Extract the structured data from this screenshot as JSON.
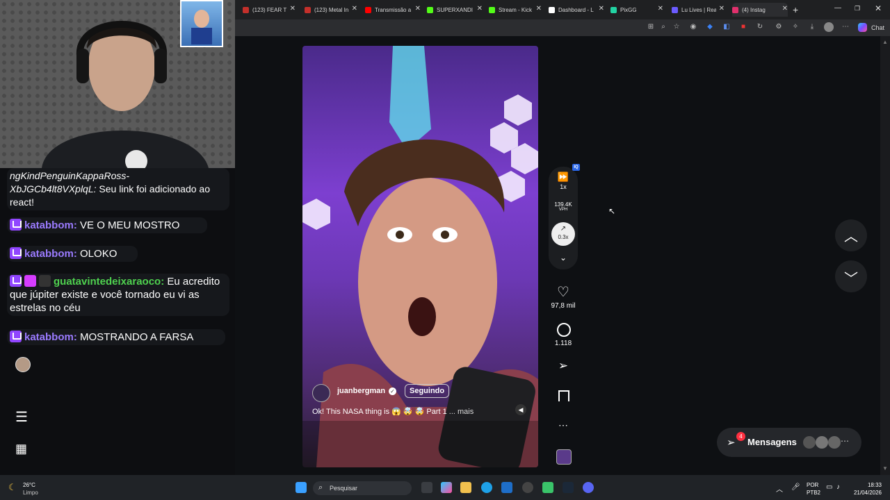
{
  "browser": {
    "tabs": [
      {
        "label": "(123) FEAR TI",
        "color": "#c4302b"
      },
      {
        "label": "(123) Metal In",
        "color": "#c4302b"
      },
      {
        "label": "Transmissão a",
        "color": "#ff0000"
      },
      {
        "label": "SUPERXANDI",
        "color": "#53fc18"
      },
      {
        "label": "Stream - Kick",
        "color": "#53fc18"
      },
      {
        "label": "Dashboard - L",
        "color": "#ffffff"
      },
      {
        "label": "PixGG",
        "color": "#22d3a3"
      },
      {
        "label": "Lu Lives | Rea",
        "color": "#6b5bff"
      },
      {
        "label": "(4) Instag",
        "color": "#e1306c"
      }
    ],
    "chat_label": "Chat"
  },
  "chat": {
    "messages": [
      {
        "user": "",
        "text": "ngKindPenguinKappaRoss-",
        "text2": "XbJGCb4lt8VXplqL:",
        "text3": "Seu link foi adicionado ao react!"
      },
      {
        "user": "katabbom:",
        "text": "VE O MEU MOSTRO"
      },
      {
        "user": "katabbom:",
        "text": "OLOKO"
      },
      {
        "user": "guatavintedeixaraoco:",
        "text": "Eu acredito que júpiter existe e você tornado eu vi as estrelas no céu"
      },
      {
        "user": "katabbom:",
        "text": "MOSTRANDO A FARSA"
      }
    ]
  },
  "reel": {
    "author": "juanbergman",
    "follow_label": "Seguindo",
    "caption": "Ok! This NASA thing is 😱 🤯 🤯 Part 1",
    "more_label": "... mais",
    "likes": "97,8 mil",
    "comments": "1.118"
  },
  "overlay_tool": {
    "speed": "1x",
    "views": "139.4K",
    "views_unit": "VPH",
    "ratio": "0.3x",
    "badge": "IQ"
  },
  "messages_panel": {
    "label": "Mensagens",
    "count": "4"
  },
  "taskbar": {
    "weather_temp": "26°C",
    "weather_desc": "Limpo",
    "search_placeholder": "Pesquisar",
    "lang": "POR",
    "layout": "PTB2",
    "time": "18:33",
    "date": "21/04/2026"
  }
}
